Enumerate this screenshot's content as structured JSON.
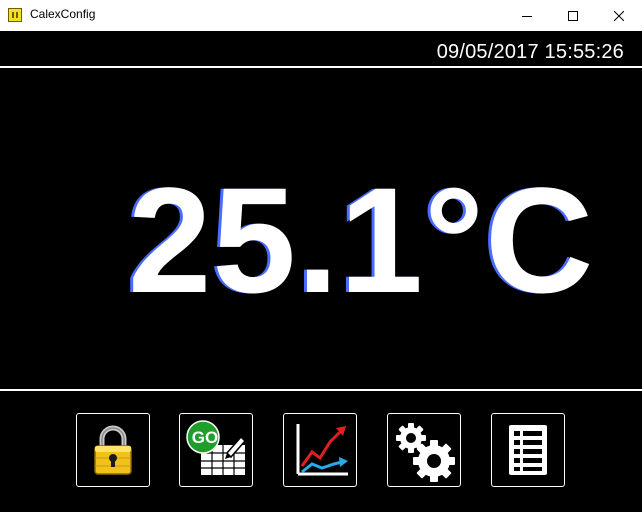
{
  "window": {
    "title": "CalexConfig"
  },
  "status": {
    "datetime": "09/05/2017 15:55:26"
  },
  "reading": {
    "temperature": "25.1°C"
  },
  "toolbar": {
    "go_label": "GO"
  },
  "icons": {
    "app": "calex-app-icon",
    "minimize": "minimize-icon",
    "maximize": "maximize-icon",
    "close": "close-icon",
    "lock": "padlock-icon",
    "go": "go-table-icon",
    "chart": "line-chart-icon",
    "settings": "gears-icon",
    "list": "list-icon"
  },
  "colors": {
    "background": "#000000",
    "foreground": "#ffffff",
    "titlebar": "#ffffff",
    "go_badge": "#1f9e2c",
    "chart_red": "#e02020",
    "chart_blue": "#2aa8e8",
    "lock_gold": "#f2c21b"
  }
}
